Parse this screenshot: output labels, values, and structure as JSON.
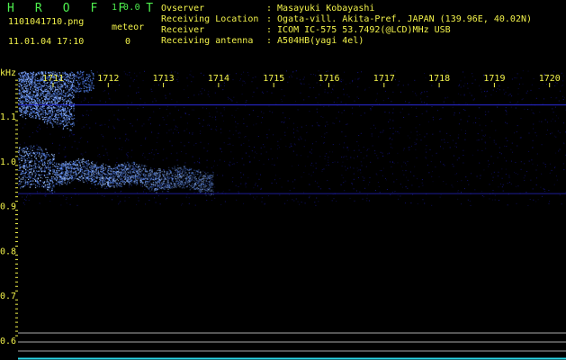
{
  "header": {
    "app_title": "H R O F F T",
    "app_version": "1.0.0",
    "filename": "1101041710.png",
    "datetime": "11.01.04 17:10",
    "meteor_label": "meteor",
    "meteor_count": "0"
  },
  "info": [
    {
      "label": "Ovserver",
      "value": ": Masayuki Kobayashi"
    },
    {
      "label": "Receiving Location",
      "value": ": Ogata-vill. Akita-Pref. JAPAN (139.96E, 40.02N)"
    },
    {
      "label": "Receiver",
      "value": ": ICOM IC-575 53.7492(@LCD)MHz USB"
    },
    {
      "label": "Receiving antenna",
      "value": ": A504HB(yagi 4el)"
    }
  ],
  "plot": {
    "y_unit": "kHz",
    "y_ticks": [
      1.1,
      1.0,
      0.9,
      0.8,
      0.7,
      0.6
    ],
    "y_tick_labels": [
      "1.1",
      "1.0",
      "0.9",
      "0.8",
      "0.7",
      "0.6"
    ],
    "time_labels": [
      "1711",
      "1712",
      "1713",
      "1714",
      "1715",
      "1716",
      "1717",
      "1718",
      "1719",
      "1720"
    ],
    "y_range_khz": [
      0.6,
      1.2
    ],
    "signal_end_minute": "1713.9",
    "colors": {
      "background": "#000000",
      "noise": "#1a1aa8",
      "signal": "#5a8cff",
      "ticks_text": "#f2f24a",
      "header_green": "#4ef04e",
      "reference_line": "#2a2ad8",
      "bottom_lines": "#c8c8c8",
      "bottom_bar": "#2ad8e8"
    }
  }
}
